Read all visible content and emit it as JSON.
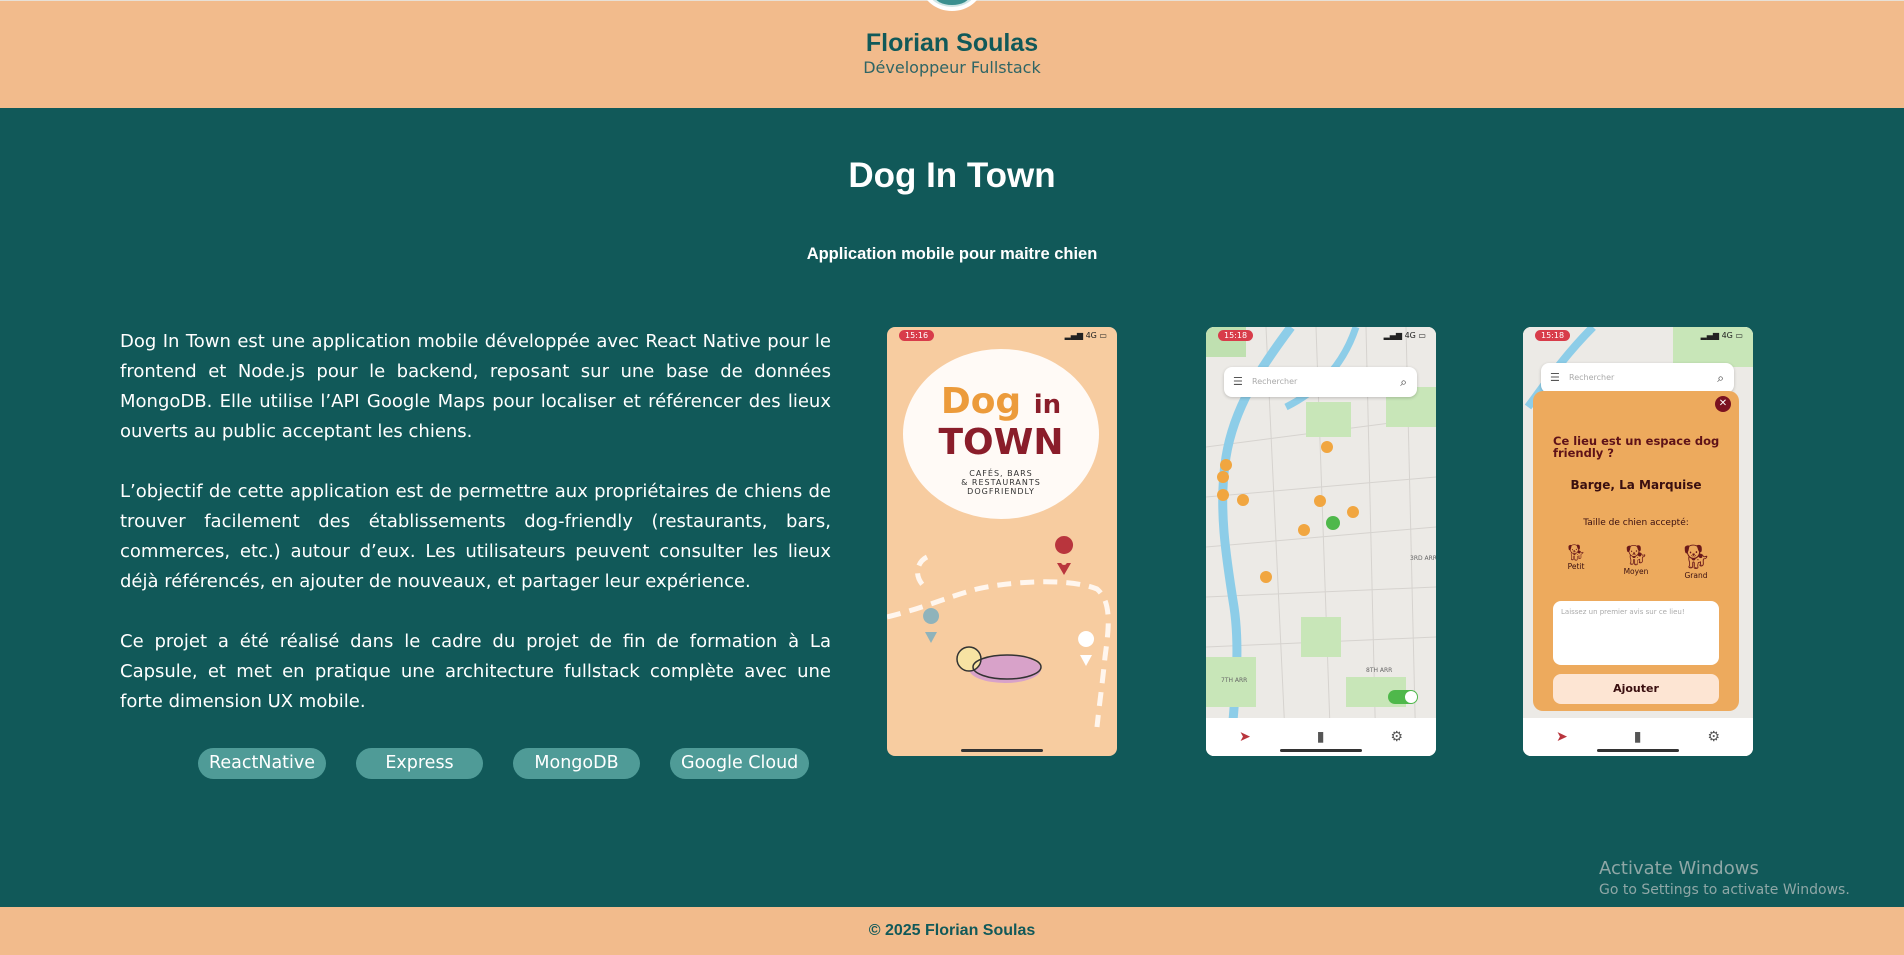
{
  "header": {
    "name": "Florian Soulas",
    "role": "Développeur Fullstack"
  },
  "project": {
    "title": "Dog In Town",
    "subtitle": "Application mobile pour maitre chien",
    "paragraphs": [
      "Dog In Town est une application mobile développée avec React Native pour le frontend et Node.js pour le backend, reposant sur une base de données MongoDB. Elle utilise l’API Google Maps pour localiser et référencer des lieux ouverts au public acceptant les chiens.",
      "L’objectif de cette application est de permettre aux propriétaires de chiens de trouver facilement des établissements dog-friendly (restaurants, bars, commerces, etc.) autour d’eux. Les utilisateurs peuvent consulter les lieux déjà référencés, en ajouter de nouveaux, et partager leur expérience.",
      "Ce projet a été réalisé dans le cadre du projet de fin de formation à La Capsule, et met en pratique une architecture fullstack complète avec une forte dimension UX mobile."
    ],
    "tags": [
      "ReactNative",
      "Express",
      "MongoDB",
      "Google Cloud"
    ]
  },
  "screens": {
    "splash": {
      "time": "15:16",
      "status": "4G",
      "logo_dog": "Dog",
      "logo_in": "in",
      "logo_town": "TOWN",
      "logo_sub_1": "CAFÉS, BARS",
      "logo_sub_2": "& RESTAURANTS",
      "logo_sub_3": "DOGFRIENDLY"
    },
    "map": {
      "time": "15:18",
      "status": "4G",
      "search_placeholder": "Rechercher",
      "labels": [
        "3RD ARR",
        "7TH ARR",
        "8TH ARR"
      ]
    },
    "modal": {
      "time": "15:18",
      "status": "4G",
      "search_placeholder": "Rechercher",
      "question": "Ce lieu est un espace dog friendly ?",
      "place": "Barge, La Marquise",
      "size_label": "Taille de chien accepté:",
      "sizes": [
        "Petit",
        "Moyen",
        "Grand"
      ],
      "comment_placeholder": "Laissez un premier avis sur ce lieu!",
      "add_button": "Ajouter"
    }
  },
  "footer": {
    "text": "© 2025 Florian Soulas"
  },
  "watermark": {
    "line1": "Activate Windows",
    "line2": "Go to Settings to activate Windows."
  }
}
